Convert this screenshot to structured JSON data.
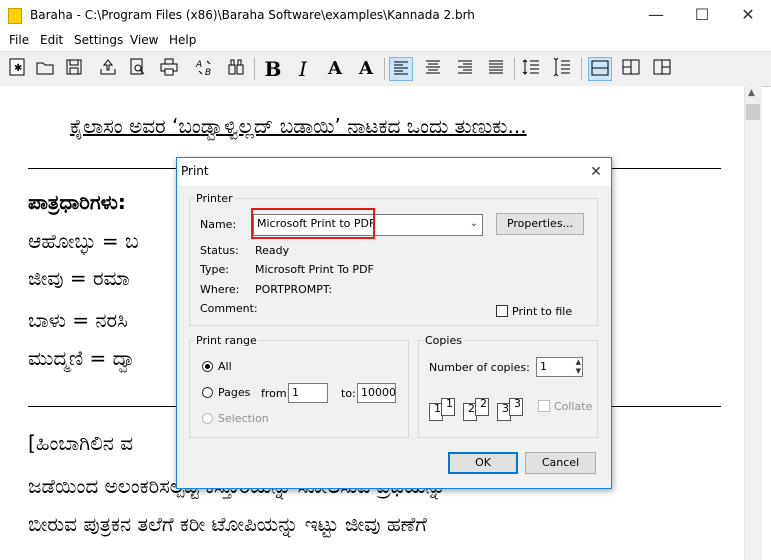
{
  "window": {
    "title": "Baraha - C:\\Program Files (x86)\\Baraha Software\\examples\\Kannada 2.brh",
    "minimize_glyph": "—",
    "maximize_glyph": "☐",
    "close_glyph": "✕"
  },
  "menu": [
    "File",
    "Edit",
    "Settings",
    "View",
    "Help"
  ],
  "toolbar": {
    "bold": "B",
    "italic": "I",
    "font_up": "A",
    "font_down": "A"
  },
  "document": {
    "heading": "ಕೈಲಾಸಂ ಅವರ ‘ಬಂಡ್ವಾಳ್ವಿಲ್ಲದ್ ಬಡಾಯಿ’ ನಾಟಕದ ಒಂದು ತುಣುಕು...",
    "lines": [
      "ಪಾತ್ರಧಾರಿಗಳು:",
      "ಆಹೋಬ್ಳು = ಬ",
      "ಜೀವು = ರಮಾ",
      "ಬಾಳು = ನರಸಿ",
      "ಮುದ್ಮಣಿ = ದ್ವಾ",
      "[ಹಿಂಬಾಗಿಲಿನ ವ",
      "ಜಡೆಯಿಂದ ಅಲಂಕರಿಸಲ್ಪಟ್ಟ ಕಸ್ತೂರಿಯನ್ನು ಸೋಲಿಸುವ ಪ್ರಭೆಯನ್ನು",
      "ಬೀರುವ ಪುತ್ರಕನ ತಲೆಗೆ ಕರೀ ಟೋಪಿಯನ್ನು ಇಟ್ಟು ಜೀವು ಹಣೆಗೆ"
    ]
  },
  "print_dialog": {
    "title": "Print",
    "close_glyph": "✕",
    "printer": {
      "group_label": "Printer",
      "name_label": "Name:",
      "name_value": "Microsoft Print to PDF",
      "properties_button": "Properties...",
      "status_label": "Status:",
      "status_value": "Ready",
      "type_label": "Type:",
      "type_value": "Microsoft Print To PDF",
      "where_label": "Where:",
      "where_value": "PORTPROMPT:",
      "comment_label": "Comment:",
      "comment_value": "",
      "print_to_file_label": "Print to file",
      "print_to_file_checked": false
    },
    "print_range": {
      "group_label": "Print range",
      "all_label": "All",
      "pages_label": "Pages",
      "from_label": "from:",
      "from_value": "1",
      "to_label": "to:",
      "to_value": "10000",
      "selection_label": "Selection",
      "selected": "All"
    },
    "copies": {
      "group_label": "Copies",
      "number_label": "Number of copies:",
      "number_value": "1",
      "collate_label": "Collate",
      "collate_checked": false,
      "page_numbers": [
        "1",
        "1",
        "2",
        "2",
        "3",
        "3"
      ]
    },
    "ok_button": "OK",
    "cancel_button": "Cancel",
    "highlight_color": "#e01b1b"
  }
}
